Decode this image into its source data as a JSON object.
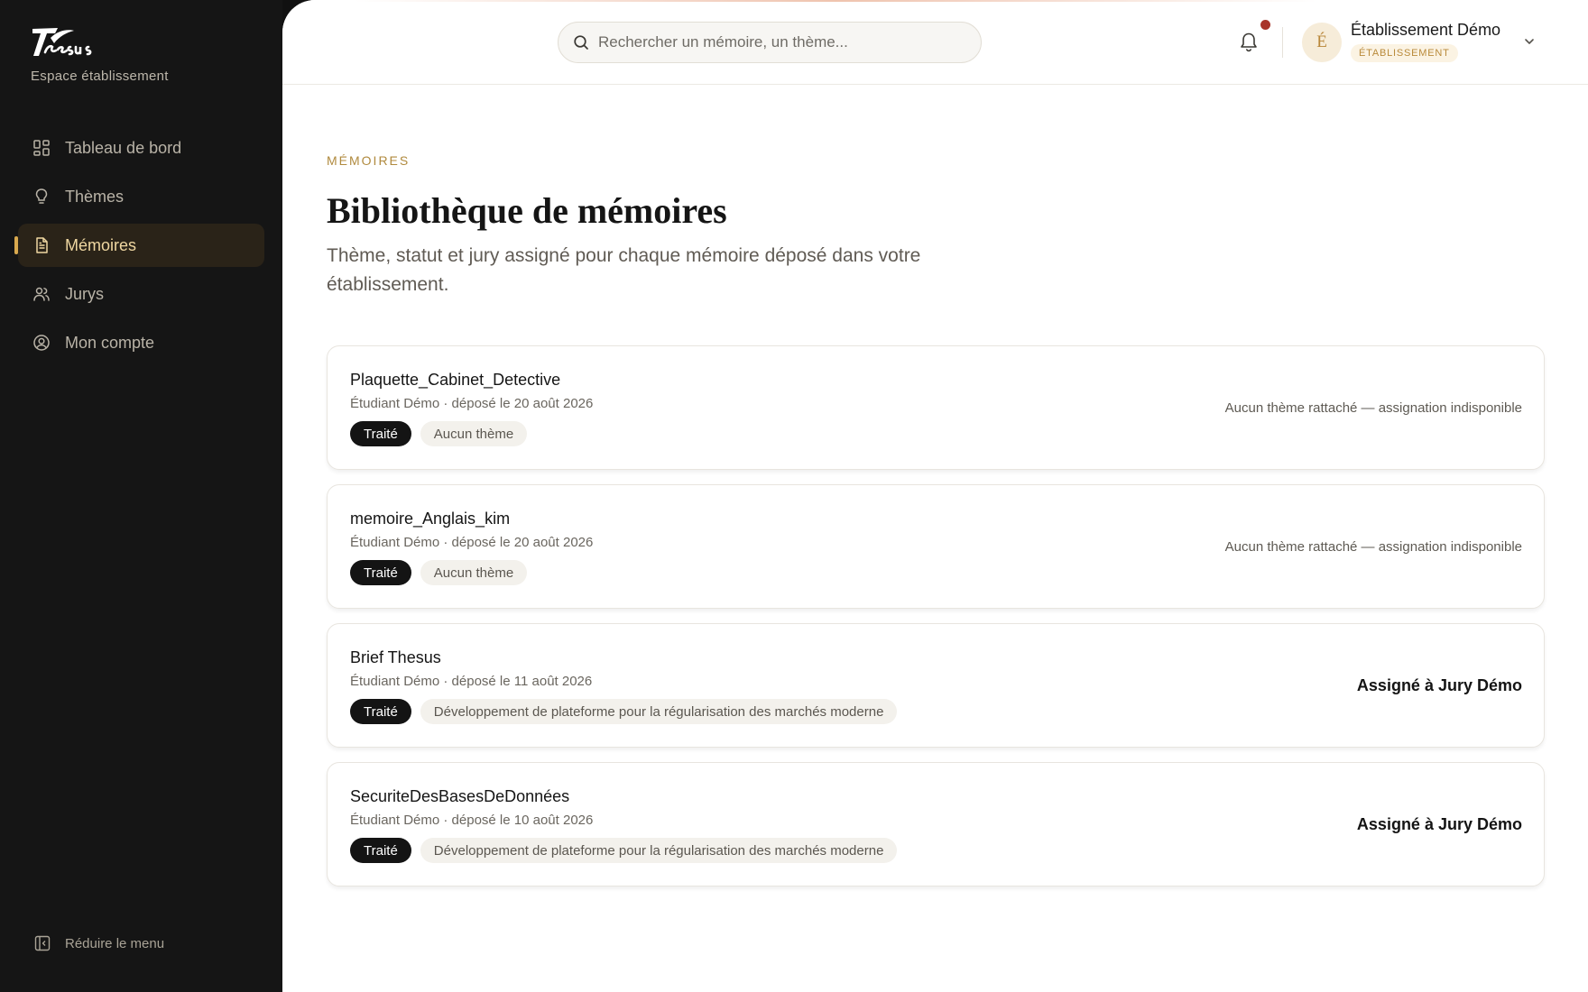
{
  "brand": {
    "logo_text": "Thesus",
    "subtitle": "Espace établissement"
  },
  "sidebar": {
    "items": [
      {
        "label": "Tableau de bord",
        "icon": "dashboard-grid-icon",
        "active": false
      },
      {
        "label": "Thèmes",
        "icon": "lightbulb-icon",
        "active": false
      },
      {
        "label": "Mémoires",
        "icon": "document-icon",
        "active": true
      },
      {
        "label": "Jurys",
        "icon": "users-icon",
        "active": false
      },
      {
        "label": "Mon compte",
        "icon": "user-circle-icon",
        "active": false
      }
    ],
    "collapse_label": "Réduire le menu"
  },
  "header": {
    "search_placeholder": "Rechercher un mémoire, un thème...",
    "user_initial": "É",
    "user_name": "Établissement Démo",
    "user_role": "ÉTABLISSEMENT"
  },
  "page": {
    "eyebrow": "MÉMOIRES",
    "title": "Bibliothèque de mémoires",
    "description": "Thème, statut et jury assigné pour chaque mémoire déposé dans votre établissement."
  },
  "memoires": [
    {
      "title": "Plaquette_Cabinet_Detective",
      "meta": "Étudiant Démo · déposé le 20 août 2026",
      "status": "Traité",
      "theme": "Aucun thème",
      "assignment": "Aucun thème rattaché — assignation indisponible"
    },
    {
      "title": "memoire_Anglais_kim",
      "meta": "Étudiant Démo · déposé le 20 août 2026",
      "status": "Traité",
      "theme": "Aucun thème",
      "assignment": "Aucun thème rattaché — assignation indisponible"
    },
    {
      "title": "Brief Thesus",
      "meta": "Étudiant Démo · déposé le 11 août 2026",
      "status": "Traité",
      "theme": "Développement de plateforme pour la régularisation des marchés moderne",
      "assignment": "Assigné à Jury Démo"
    },
    {
      "title": "SecuriteDesBasesDeDonnées",
      "meta": "Étudiant Démo · déposé le 10 août 2026",
      "status": "Traité",
      "theme": "Développement de plateforme pour la régularisation des marchés moderne",
      "assignment": "Assigné à Jury Démo"
    }
  ],
  "colors": {
    "sidebar_bg": "#151515",
    "accent": "#d9a94e",
    "active_bg": "#2a2318",
    "notification": "#a8342a"
  }
}
